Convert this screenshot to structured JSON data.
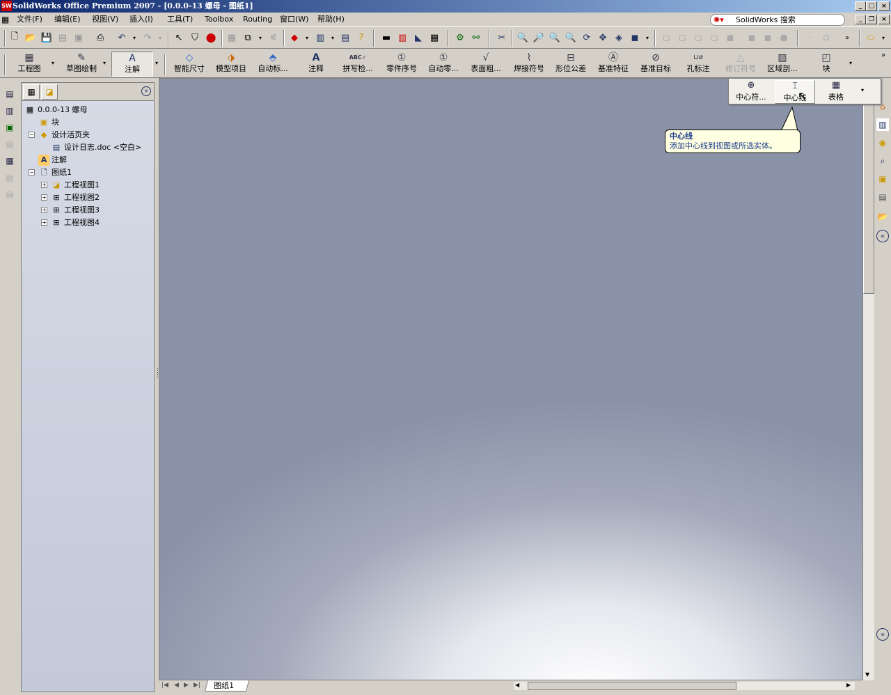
{
  "window": {
    "title": "SolidWorks Office Premium 2007 - [0.0.0-13 螺母 - 图纸1]",
    "app_icon_label": "SW"
  },
  "menus": [
    "文件(F)",
    "编辑(E)",
    "视图(V)",
    "插入(I)",
    "工具(T)",
    "Toolbox",
    "Routing",
    "窗口(W)",
    "帮助(H)"
  ],
  "search": {
    "label": "SolidWorks 搜索"
  },
  "command_manager": {
    "items": [
      {
        "label": "工程图",
        "icon": "drawing-icon"
      },
      {
        "label": "草图绘制",
        "icon": "sketch-icon"
      },
      {
        "label": "注解",
        "icon": "annotation-icon",
        "selected": true
      },
      {
        "label": "智能尺寸",
        "icon": "smart-dimension-icon"
      },
      {
        "label": "模型项目",
        "icon": "model-items-icon"
      },
      {
        "label": "自动标...",
        "icon": "autoballoon-icon"
      },
      {
        "label": "注释",
        "icon": "note-icon"
      },
      {
        "label": "拼写检...",
        "icon": "spell-check-icon"
      },
      {
        "label": "零件序号",
        "icon": "balloon-icon"
      },
      {
        "label": "自动零...",
        "icon": "auto-balloon-icon"
      },
      {
        "label": "表面粗...",
        "icon": "surface-finish-icon"
      },
      {
        "label": "焊接符号",
        "icon": "weld-symbol-icon"
      },
      {
        "label": "形位公差",
        "icon": "geometric-tolerance-icon"
      },
      {
        "label": "基准特征",
        "icon": "datum-feature-icon"
      },
      {
        "label": "基准目标",
        "icon": "datum-target-icon"
      },
      {
        "label": "孔标注",
        "icon": "hole-callout-icon"
      },
      {
        "label": "修订符号",
        "icon": "revision-symbol-icon",
        "disabled": true
      },
      {
        "label": "区域剖...",
        "icon": "area-hatch-icon"
      },
      {
        "label": "块",
        "icon": "block-icon"
      }
    ]
  },
  "flyout": {
    "items": [
      {
        "label": "中心符...",
        "icon": "center-mark-icon"
      },
      {
        "label": "中心线",
        "icon": "centerline-icon",
        "hover": true
      },
      {
        "label": "表格",
        "icon": "table-icon"
      }
    ]
  },
  "tooltip": {
    "title": "中心线",
    "text": "添加中心线到视图或所选实体。"
  },
  "feature_tree": {
    "root": "0.0.0-13 螺母",
    "nodes": [
      {
        "label": "块"
      },
      {
        "label": "设计活页夹"
      },
      {
        "label": "设计日志.doc <空白>"
      },
      {
        "label": "注解"
      },
      {
        "label": "图纸1"
      },
      {
        "label": "工程视图1"
      },
      {
        "label": "工程视图2"
      },
      {
        "label": "工程视图3"
      },
      {
        "label": "工程视图4"
      }
    ]
  },
  "sheet_tab": {
    "label": "图纸1"
  }
}
